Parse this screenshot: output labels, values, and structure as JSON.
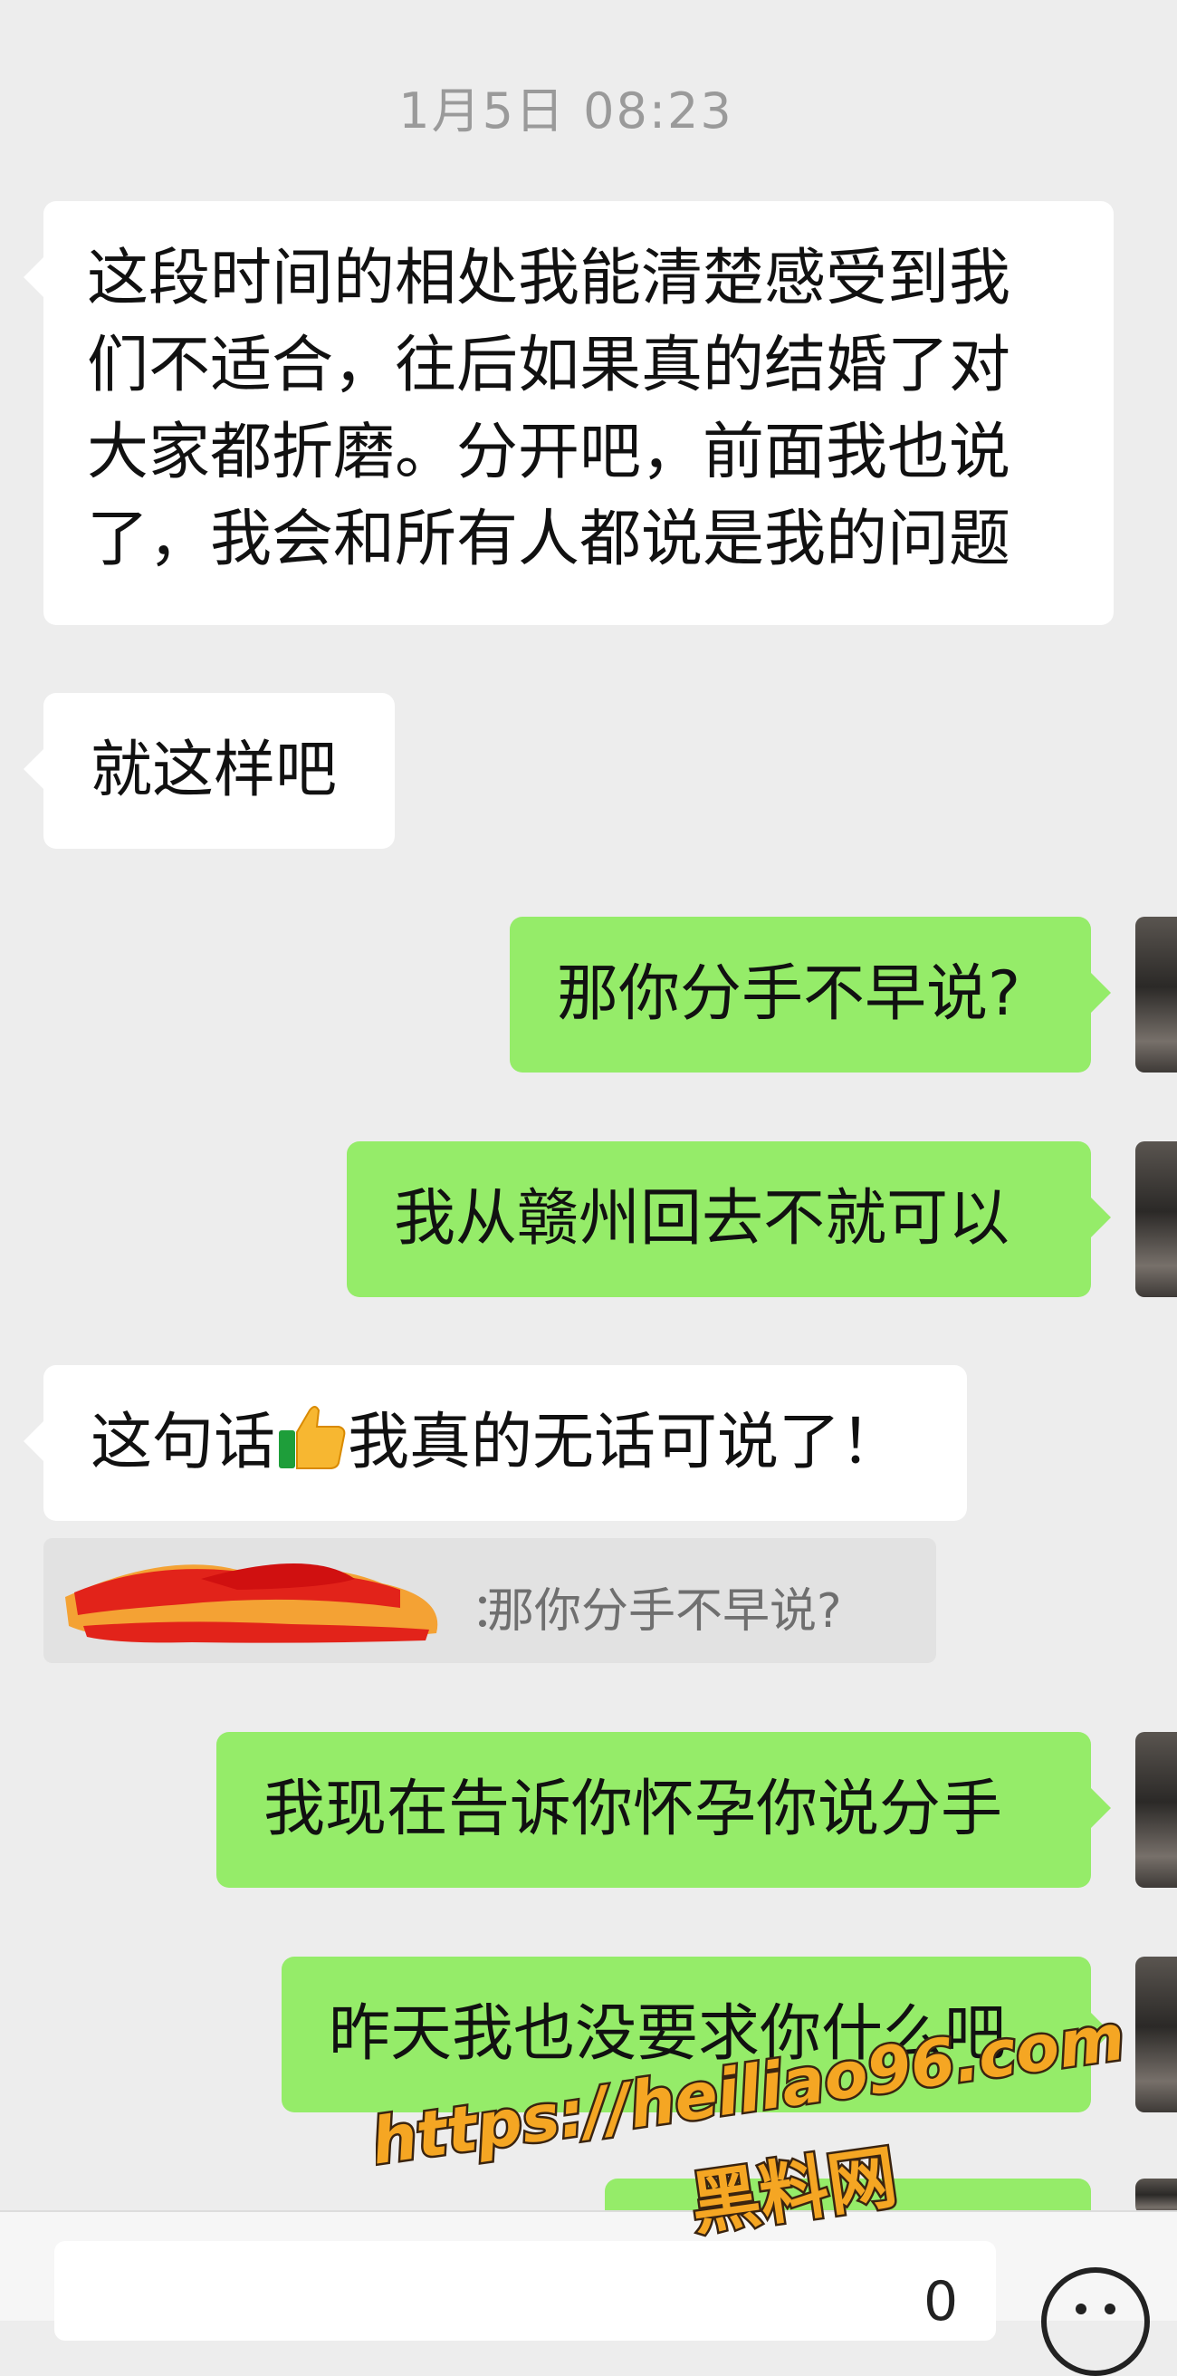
{
  "chat": {
    "timestamp": "1月5日 08:23",
    "messages": [
      {
        "side": "in",
        "lines": [
          "这段时间的相处我能清楚感受到我",
          "们不适合，往后如果真的结婚了对",
          "大家都折磨。分开吧，前面我也说",
          "了，我会和所有人都说是我的问题"
        ]
      },
      {
        "side": "in",
        "text": "就这样吧"
      },
      {
        "side": "out",
        "text": "那你分手不早说?"
      },
      {
        "side": "out",
        "text": "我从赣州回去不就可以"
      },
      {
        "side": "in",
        "text_before": "这句话",
        "emoji": "thumbs-up-emoji",
        "text_after": "我真的无话可说了！"
      },
      {
        "side": "out",
        "text": "我现在告诉你怀孕你说分手"
      },
      {
        "side": "out",
        "text": "昨天我也没要求你什么吧"
      }
    ],
    "quote": {
      "sender_redacted": true,
      "colon": "：",
      "text": "那你分手不早说?"
    }
  },
  "input_bar": {
    "visible_glyph": "0",
    "emoji_icon": "emoji-face-icon"
  },
  "watermark": {
    "url": "https://heiliao96.com",
    "label": "黑料网"
  },
  "colors": {
    "background": "#ededed",
    "incoming": "#ffffff",
    "outgoing": "#95ec69",
    "watermark": "#f5a623"
  }
}
